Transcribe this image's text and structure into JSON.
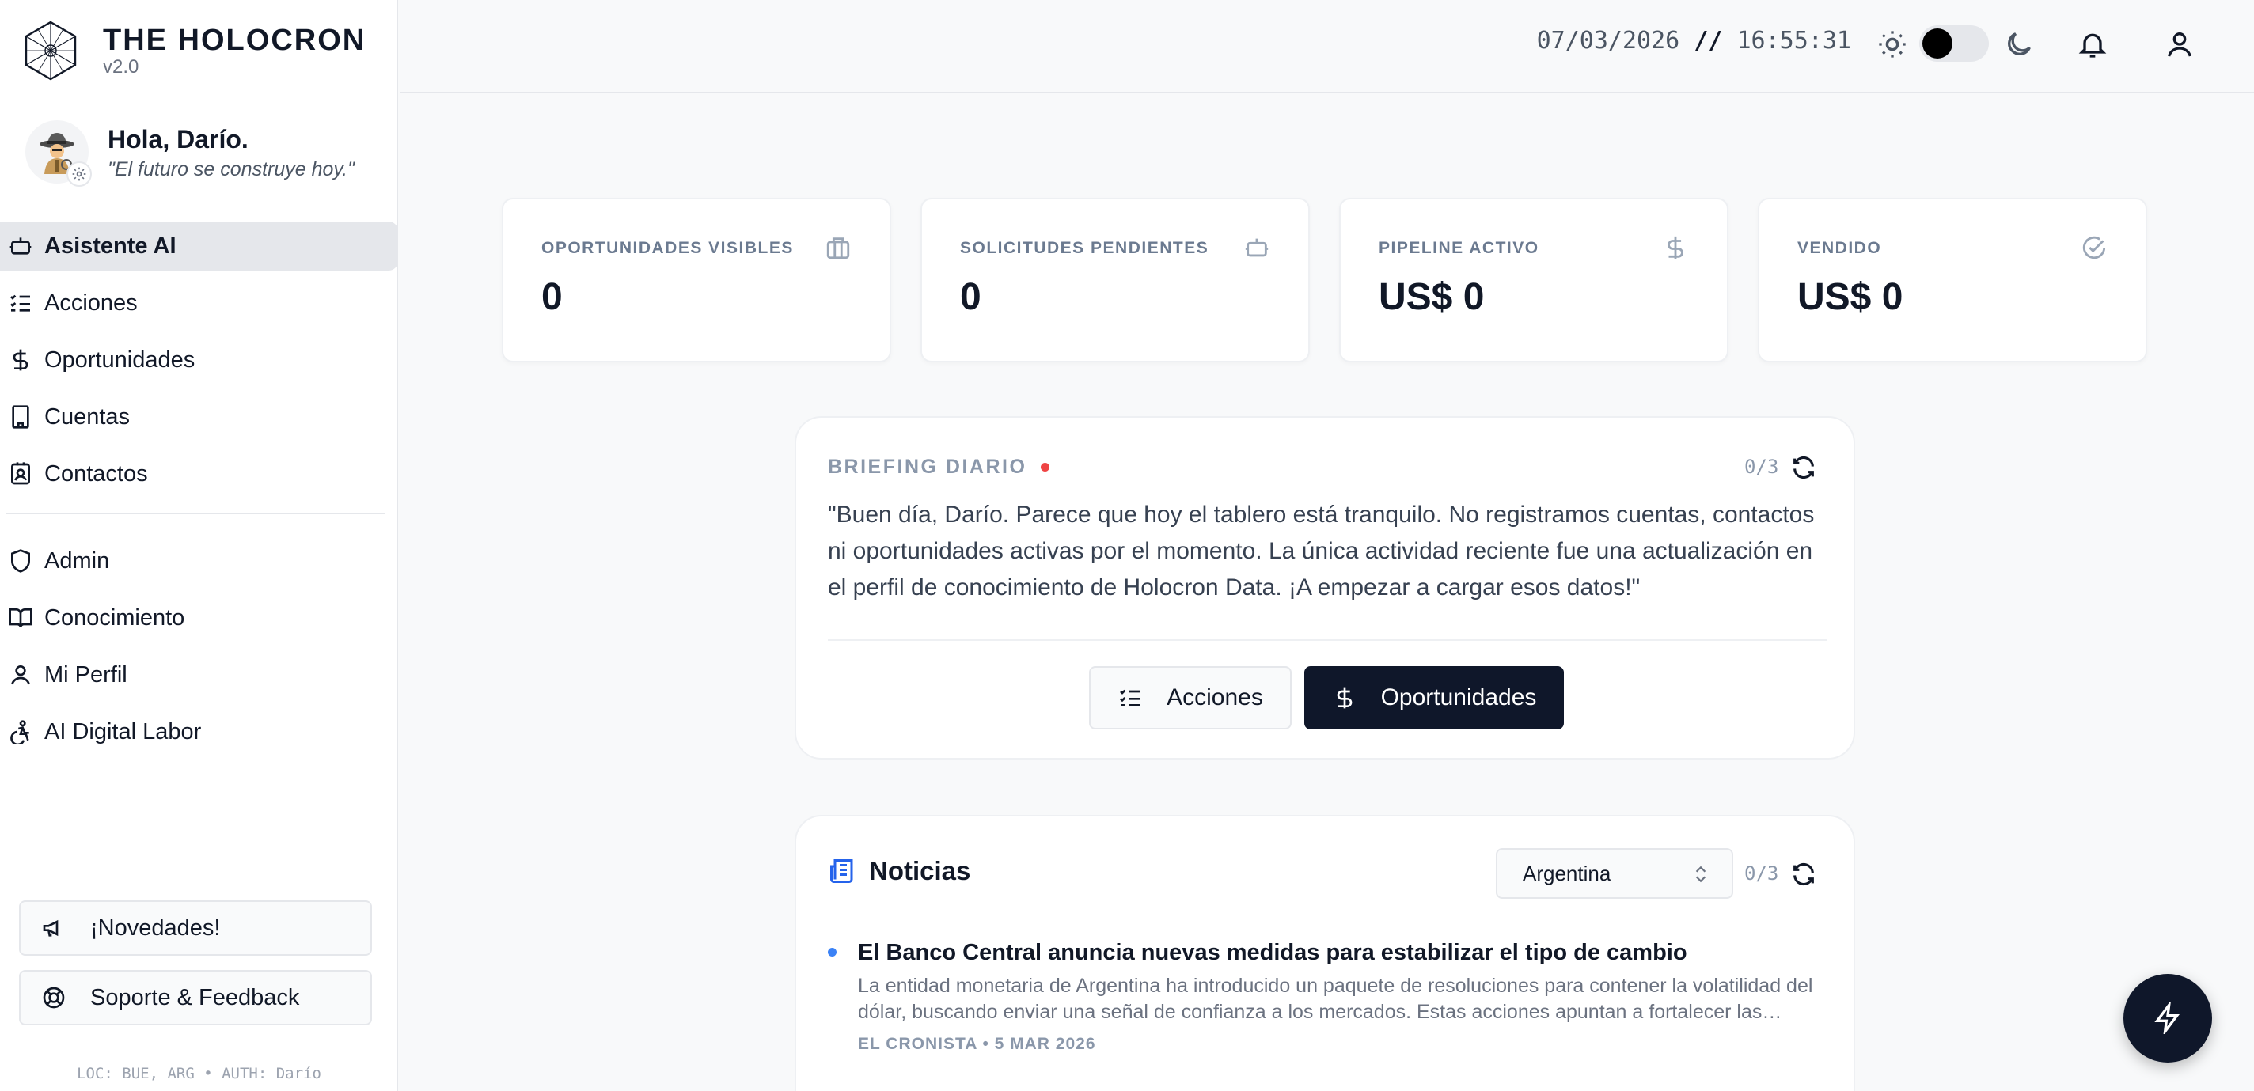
{
  "brand": {
    "name": "THE HOLOCRON",
    "version": "v2.0"
  },
  "user": {
    "greeting": "Hola, Darío.",
    "quote": "\"El futuro se construye hoy.\""
  },
  "nav": {
    "primary": [
      {
        "label": "Asistente AI",
        "icon": "robot-icon",
        "active": true
      },
      {
        "label": "Acciones",
        "icon": "list-check-icon"
      },
      {
        "label": "Oportunidades",
        "icon": "dollar-icon"
      },
      {
        "label": "Cuentas",
        "icon": "building-icon"
      },
      {
        "label": "Contactos",
        "icon": "contact-card-icon"
      }
    ],
    "secondary": [
      {
        "label": "Admin",
        "icon": "shield-icon"
      },
      {
        "label": "Conocimiento",
        "icon": "book-icon"
      },
      {
        "label": "Mi Perfil",
        "icon": "user-icon"
      },
      {
        "label": "AI Digital Labor",
        "icon": "accessibility-icon"
      }
    ]
  },
  "sidebar_buttons": {
    "news": "¡Novedades!",
    "support": "Soporte & Feedback"
  },
  "footer": "LOC: BUE, ARG • AUTH: Darío",
  "topbar": {
    "date": "07/03/2026",
    "separator": "//",
    "time": "16:55:31"
  },
  "stats": [
    {
      "label": "OPORTUNIDADES VISIBLES",
      "value": "0",
      "icon": "briefcase-icon"
    },
    {
      "label": "SOLICITUDES PENDIENTES",
      "value": "0",
      "icon": "robot-icon"
    },
    {
      "label": "PIPELINE ACTIVO",
      "value": "US$ 0",
      "icon": "dollar-icon"
    },
    {
      "label": "VENDIDO",
      "value": "US$ 0",
      "icon": "check-circle-icon"
    }
  ],
  "briefing": {
    "label": "BRIEFING DIARIO",
    "counter": "0/3",
    "text": "\"Buen día, Darío. Parece que hoy el tablero está tranquilo. No registramos cuentas, contactos ni oportunidades activas por el momento. La única actividad reciente fue una actualización en el perfil de conocimiento de Holocron Data. ¡A empezar a cargar esos datos!\"",
    "btn_actions": "Acciones",
    "btn_opps": "Oportunidades"
  },
  "news": {
    "title": "Noticias",
    "region": "Argentina",
    "counter": "0/3",
    "items": [
      {
        "headline": "El Banco Central anuncia nuevas medidas para estabilizar el tipo de cambio",
        "summary": "La entidad monetaria de Argentina ha introducido un paquete de resoluciones para contener la volatilidad del dólar, buscando enviar una señal de confianza a los mercados. Estas acciones apuntan a fortalecer las reservas.",
        "meta": "EL CRONISTA • 5 MAR 2026"
      }
    ]
  },
  "colors": {
    "accent": "#0f172a",
    "active_bg": "#e5e7eb",
    "live_dot": "#ef4444",
    "news_dot": "#3b82f6",
    "news_icon": "#2563eb"
  }
}
